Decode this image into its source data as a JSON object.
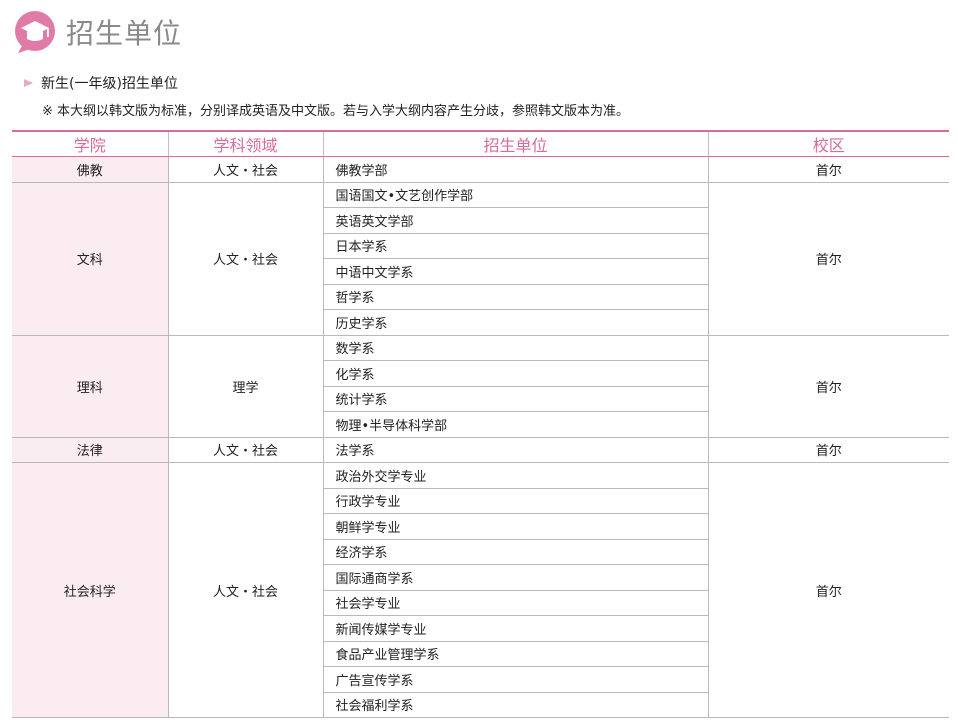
{
  "page": {
    "title": "招生单位",
    "subtitle": "新生(一年级)招生单位",
    "note": "※ 本大纲以韩文版为标准，分别译成英语及中文版。若与入学大纲内容产生分歧，参照韩文版本为准。",
    "logo_icon": "graduation-cap-icon",
    "accent_color": "#d96a9c",
    "college_bg_color": "#fbecf2"
  },
  "table": {
    "headers": [
      "学院",
      "学科领域",
      "招生单位",
      "校区"
    ],
    "groups": [
      {
        "college": "佛教",
        "field": "人文・社会",
        "campus": "首尔",
        "units": [
          "佛教学部"
        ]
      },
      {
        "college": "文科",
        "field": "人文・社会",
        "campus": "首尔",
        "units": [
          "国语国文•文艺创作学部",
          "英语英文学部",
          "日本学系",
          "中语中文学系",
          "哲学系",
          "历史学系"
        ]
      },
      {
        "college": "理科",
        "field": "理学",
        "campus": "首尔",
        "units": [
          "数学系",
          "化学系",
          "统计学系",
          "物理•半导体科学部"
        ]
      },
      {
        "college": "法律",
        "field": "人文・社会",
        "campus": "首尔",
        "units": [
          "法学系"
        ]
      },
      {
        "college": "社会科学",
        "field": "人文・社会",
        "campus": "首尔",
        "units": [
          "政治外交学专业",
          "行政学专业",
          "朝鲜学专业",
          "经济学系",
          "国际通商学系",
          "社会学专业",
          "新闻传媒学专业",
          "食品产业管理学系",
          "广告宣传学系",
          "社会福利学系"
        ]
      }
    ]
  }
}
